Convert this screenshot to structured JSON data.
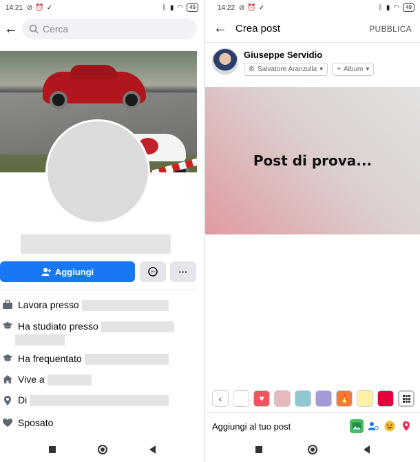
{
  "left": {
    "status": {
      "time": "14:21",
      "battery": "49"
    },
    "search": {
      "placeholder": "Cerca"
    },
    "buttons": {
      "add": "Aggiungi",
      "more": "···"
    },
    "info": [
      {
        "icon": "briefcase-icon",
        "label": "Lavora presso"
      },
      {
        "icon": "graduation-cap-icon",
        "label": "Ha studiato presso"
      },
      {
        "icon": "graduation-cap-icon",
        "label": "Ha frequentato"
      },
      {
        "icon": "home-icon",
        "label": "Vive a"
      },
      {
        "icon": "location-pin-icon",
        "label": "Di"
      },
      {
        "icon": "heart-icon",
        "label": "Sposato"
      }
    ]
  },
  "right": {
    "status": {
      "time": "14:22",
      "battery": "49"
    },
    "header": {
      "title": "Crea post",
      "publish": "PUBBLICA"
    },
    "author": {
      "name": "Giuseppe Servidio",
      "audience": "Salvatore Aranzulla",
      "album": "Album"
    },
    "post": {
      "text": "Post di prova..."
    },
    "palette": [
      {
        "name": "white",
        "color": "#ffffff"
      },
      {
        "name": "heart",
        "color": "#f2555e"
      },
      {
        "name": "pink-gradient",
        "color": "#e7b9bd"
      },
      {
        "name": "teal-gradient",
        "color": "#8ec9d3"
      },
      {
        "name": "purple",
        "color": "#a49bd6"
      },
      {
        "name": "fire",
        "color": "#f5793b"
      },
      {
        "name": "yellow",
        "color": "#fff2a6"
      },
      {
        "name": "red",
        "color": "#e4003a"
      }
    ],
    "add_to_post": "Aggiungi al tuo post"
  },
  "colors": {
    "accent": "#1877f2"
  }
}
